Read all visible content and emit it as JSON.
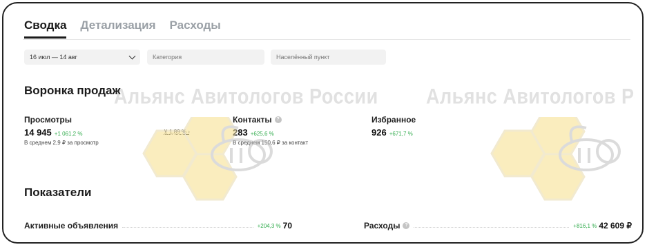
{
  "tabs": [
    {
      "label": "Сводка",
      "active": true
    },
    {
      "label": "Детализация",
      "active": false
    },
    {
      "label": "Расходы",
      "active": false
    }
  ],
  "filters": {
    "date": "16 июл — 14 авг",
    "category_placeholder": "Категория",
    "city_placeholder": "Населённый пункт"
  },
  "funnel": {
    "title": "Воронка продаж",
    "views": {
      "label": "Просмотры",
      "value": "14 945",
      "delta": "+1 061,2 %",
      "sub": "В среднем 2,9 ₽ за просмотр"
    },
    "conversion": "1,89 %",
    "contacts": {
      "label": "Контакты",
      "value": "283",
      "delta": "+625,6 %",
      "sub": "В среднем 150,6 ₽ за контакт"
    },
    "favorites": {
      "label": "Избранное",
      "value": "926",
      "delta": "+671,7 %"
    }
  },
  "indicators": {
    "title": "Показатели",
    "active": {
      "label": "Активные объявления",
      "delta": "+204,3 %",
      "value": "70"
    },
    "expenses": {
      "label": "Расходы",
      "delta": "+816,1 %",
      "value": "42 609 ₽"
    }
  },
  "watermark": "Альянс Авитологов России",
  "colors": {
    "positive": "#2eaa4a",
    "honeycomb": "#f7df8a",
    "inactive_tab": "#9aa0a6"
  }
}
